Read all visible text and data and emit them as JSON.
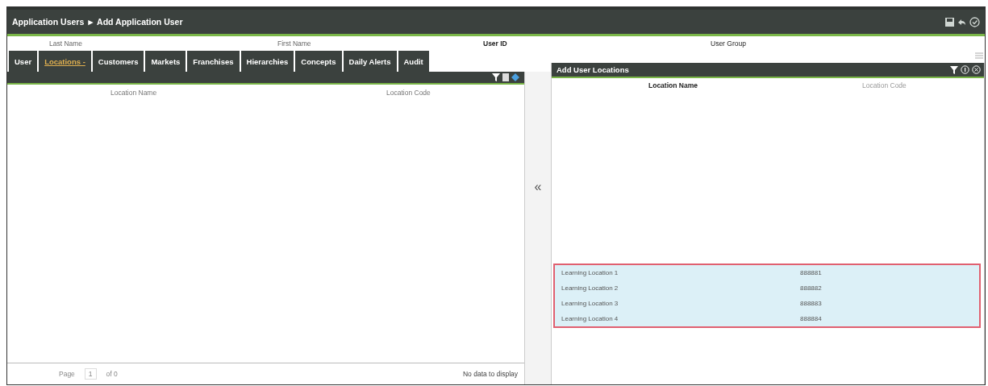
{
  "window": {
    "title": "Application Users ► Add Application User"
  },
  "fields": [
    {
      "label": "Last Name"
    },
    {
      "label": "First Name"
    },
    {
      "label": "User ID"
    },
    {
      "label": "User Group"
    }
  ],
  "tabs": [
    {
      "label": "User",
      "selected": false
    },
    {
      "label": "Locations -",
      "selected": true
    },
    {
      "label": "Customers",
      "selected": false
    },
    {
      "label": "Markets",
      "selected": false
    },
    {
      "label": "Franchises",
      "selected": false
    },
    {
      "label": "Hierarchies",
      "selected": false
    },
    {
      "label": "Concepts",
      "selected": false
    },
    {
      "label": "Daily Alerts",
      "selected": false
    },
    {
      "label": "Audit",
      "selected": false
    }
  ],
  "left_grid": {
    "columns": [
      "Location Name",
      "Location Code"
    ],
    "pager": {
      "page_label": "Page",
      "page_value": "1",
      "of_label": "of 0"
    },
    "status": "No data to display"
  },
  "move_button": {
    "label": "«"
  },
  "right_grid": {
    "title": "Add User Locations",
    "columns": [
      "Location Name",
      "Location Code"
    ],
    "rows": [
      {
        "name": "Learning Location 1",
        "code": "888881",
        "selected": true
      },
      {
        "name": "Learning Location 2",
        "code": "888882",
        "selected": true
      },
      {
        "name": "Learning Location 3",
        "code": "888883",
        "selected": true
      },
      {
        "name": "Learning Location 4",
        "code": "888884",
        "selected": true
      }
    ]
  }
}
